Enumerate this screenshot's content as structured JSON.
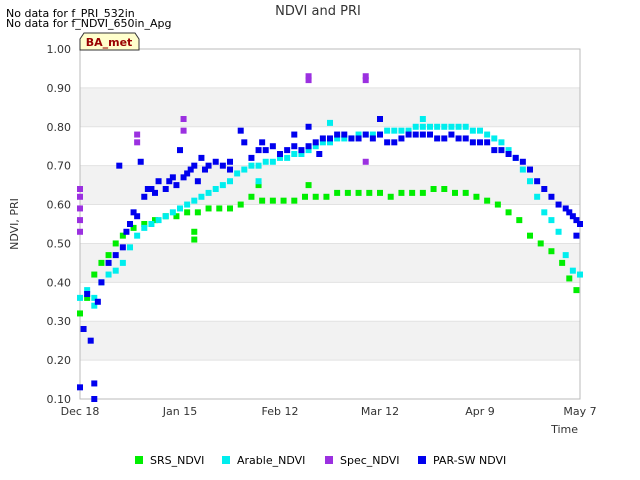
{
  "notes": [
    "No data for f_PRI_532in",
    "No data for f_NDVI_650in_Apg"
  ],
  "badge": {
    "label": "BA_met"
  },
  "chart_data": {
    "type": "scatter",
    "title": "NDVI and PRI",
    "xlabel": "Time",
    "ylabel": "NDVI, PRI",
    "ylim": [
      0.1,
      1.0
    ],
    "yticks": [
      "0.10",
      "0.20",
      "0.30",
      "0.40",
      "0.50",
      "0.60",
      "0.70",
      "0.80",
      "0.90",
      "1.00"
    ],
    "xlim_days": [
      0,
      140
    ],
    "xticks": [
      {
        "label": "Dec 18",
        "day": 0
      },
      {
        "label": "Jan 15",
        "day": 28
      },
      {
        "label": "Feb 12",
        "day": 56
      },
      {
        "label": "Mar 12",
        "day": 84
      },
      {
        "label": "Apr 9",
        "day": 112
      },
      {
        "label": "May 7",
        "day": 140
      }
    ],
    "grid": "horizontal bands",
    "legend_position": "bottom",
    "series": [
      {
        "name": "SRS_NDVI",
        "color": "#00ee00",
        "points": [
          [
            0,
            0.32
          ],
          [
            2,
            0.36
          ],
          [
            4,
            0.42
          ],
          [
            6,
            0.45
          ],
          [
            8,
            0.47
          ],
          [
            10,
            0.5
          ],
          [
            12,
            0.52
          ],
          [
            15,
            0.54
          ],
          [
            18,
            0.55
          ],
          [
            21,
            0.56
          ],
          [
            24,
            0.57
          ],
          [
            27,
            0.57
          ],
          [
            30,
            0.58
          ],
          [
            33,
            0.58
          ],
          [
            36,
            0.59
          ],
          [
            39,
            0.59
          ],
          [
            42,
            0.59
          ],
          [
            45,
            0.6
          ],
          [
            48,
            0.62
          ],
          [
            51,
            0.61
          ],
          [
            54,
            0.61
          ],
          [
            57,
            0.61
          ],
          [
            60,
            0.61
          ],
          [
            63,
            0.62
          ],
          [
            66,
            0.62
          ],
          [
            69,
            0.62
          ],
          [
            72,
            0.63
          ],
          [
            75,
            0.63
          ],
          [
            78,
            0.63
          ],
          [
            81,
            0.63
          ],
          [
            84,
            0.63
          ],
          [
            87,
            0.62
          ],
          [
            90,
            0.63
          ],
          [
            93,
            0.63
          ],
          [
            96,
            0.63
          ],
          [
            99,
            0.64
          ],
          [
            102,
            0.64
          ],
          [
            105,
            0.63
          ],
          [
            108,
            0.63
          ],
          [
            111,
            0.62
          ],
          [
            114,
            0.61
          ],
          [
            117,
            0.6
          ],
          [
            120,
            0.58
          ],
          [
            123,
            0.56
          ],
          [
            126,
            0.52
          ],
          [
            129,
            0.5
          ],
          [
            132,
            0.48
          ],
          [
            135,
            0.45
          ],
          [
            137,
            0.41
          ],
          [
            139,
            0.38
          ],
          [
            32,
            0.51
          ],
          [
            32,
            0.53
          ],
          [
            50,
            0.65
          ],
          [
            64,
            0.65
          ]
        ]
      },
      {
        "name": "Arable_NDVI",
        "color": "#00eeee",
        "points": [
          [
            0,
            0.36
          ],
          [
            2,
            0.38
          ],
          [
            4,
            0.36
          ],
          [
            6,
            0.4
          ],
          [
            8,
            0.42
          ],
          [
            10,
            0.43
          ],
          [
            12,
            0.45
          ],
          [
            14,
            0.49
          ],
          [
            16,
            0.52
          ],
          [
            18,
            0.54
          ],
          [
            20,
            0.55
          ],
          [
            22,
            0.56
          ],
          [
            24,
            0.57
          ],
          [
            26,
            0.58
          ],
          [
            28,
            0.59
          ],
          [
            30,
            0.6
          ],
          [
            32,
            0.61
          ],
          [
            34,
            0.62
          ],
          [
            36,
            0.63
          ],
          [
            38,
            0.64
          ],
          [
            40,
            0.65
          ],
          [
            42,
            0.66
          ],
          [
            44,
            0.68
          ],
          [
            46,
            0.69
          ],
          [
            48,
            0.7
          ],
          [
            50,
            0.7
          ],
          [
            52,
            0.71
          ],
          [
            54,
            0.71
          ],
          [
            56,
            0.72
          ],
          [
            58,
            0.72
          ],
          [
            60,
            0.73
          ],
          [
            62,
            0.73
          ],
          [
            64,
            0.74
          ],
          [
            66,
            0.75
          ],
          [
            68,
            0.76
          ],
          [
            70,
            0.76
          ],
          [
            72,
            0.77
          ],
          [
            74,
            0.77
          ],
          [
            76,
            0.77
          ],
          [
            78,
            0.78
          ],
          [
            80,
            0.78
          ],
          [
            82,
            0.78
          ],
          [
            84,
            0.78
          ],
          [
            86,
            0.79
          ],
          [
            88,
            0.79
          ],
          [
            90,
            0.79
          ],
          [
            92,
            0.79
          ],
          [
            94,
            0.8
          ],
          [
            96,
            0.8
          ],
          [
            98,
            0.8
          ],
          [
            100,
            0.8
          ],
          [
            102,
            0.8
          ],
          [
            104,
            0.8
          ],
          [
            106,
            0.8
          ],
          [
            108,
            0.8
          ],
          [
            110,
            0.79
          ],
          [
            112,
            0.79
          ],
          [
            114,
            0.78
          ],
          [
            116,
            0.77
          ],
          [
            118,
            0.76
          ],
          [
            120,
            0.74
          ],
          [
            122,
            0.72
          ],
          [
            124,
            0.69
          ],
          [
            126,
            0.66
          ],
          [
            128,
            0.62
          ],
          [
            130,
            0.58
          ],
          [
            132,
            0.56
          ],
          [
            134,
            0.53
          ],
          [
            136,
            0.47
          ],
          [
            138,
            0.43
          ],
          [
            140,
            0.42
          ],
          [
            4,
            0.34
          ],
          [
            50,
            0.66
          ],
          [
            70,
            0.81
          ],
          [
            96,
            0.82
          ]
        ]
      },
      {
        "name": "Spec_NDVI",
        "color": "#9b30e0",
        "points": [
          [
            0,
            0.53
          ],
          [
            0,
            0.56
          ],
          [
            0,
            0.59
          ],
          [
            0,
            0.62
          ],
          [
            0,
            0.64
          ],
          [
            16,
            0.76
          ],
          [
            16,
            0.78
          ],
          [
            29,
            0.79
          ],
          [
            29,
            0.82
          ],
          [
            64,
            0.92
          ],
          [
            64,
            0.93
          ],
          [
            80,
            0.92
          ],
          [
            80,
            0.93
          ],
          [
            80,
            0.71
          ]
        ]
      },
      {
        "name": "PAR-SW NDVI",
        "color": "#0000ee",
        "points": [
          [
            0,
            0.13
          ],
          [
            1,
            0.28
          ],
          [
            2,
            0.37
          ],
          [
            3,
            0.25
          ],
          [
            4,
            0.14
          ],
          [
            4,
            0.1
          ],
          [
            5,
            0.35
          ],
          [
            6,
            0.4
          ],
          [
            8,
            0.45
          ],
          [
            10,
            0.47
          ],
          [
            11,
            0.7
          ],
          [
            12,
            0.49
          ],
          [
            13,
            0.53
          ],
          [
            14,
            0.55
          ],
          [
            15,
            0.58
          ],
          [
            16,
            0.57
          ],
          [
            17,
            0.71
          ],
          [
            18,
            0.62
          ],
          [
            19,
            0.64
          ],
          [
            20,
            0.64
          ],
          [
            21,
            0.63
          ],
          [
            22,
            0.66
          ],
          [
            24,
            0.64
          ],
          [
            25,
            0.66
          ],
          [
            26,
            0.67
          ],
          [
            27,
            0.65
          ],
          [
            28,
            0.74
          ],
          [
            29,
            0.67
          ],
          [
            30,
            0.68
          ],
          [
            31,
            0.69
          ],
          [
            32,
            0.7
          ],
          [
            33,
            0.66
          ],
          [
            34,
            0.72
          ],
          [
            35,
            0.69
          ],
          [
            36,
            0.7
          ],
          [
            38,
            0.71
          ],
          [
            40,
            0.7
          ],
          [
            42,
            0.71
          ],
          [
            45,
            0.79
          ],
          [
            46,
            0.76
          ],
          [
            48,
            0.72
          ],
          [
            50,
            0.74
          ],
          [
            51,
            0.76
          ],
          [
            52,
            0.74
          ],
          [
            54,
            0.75
          ],
          [
            56,
            0.73
          ],
          [
            58,
            0.74
          ],
          [
            60,
            0.75
          ],
          [
            60,
            0.78
          ],
          [
            62,
            0.74
          ],
          [
            64,
            0.75
          ],
          [
            64,
            0.8
          ],
          [
            66,
            0.76
          ],
          [
            67,
            0.73
          ],
          [
            68,
            0.77
          ],
          [
            70,
            0.77
          ],
          [
            72,
            0.78
          ],
          [
            74,
            0.78
          ],
          [
            76,
            0.77
          ],
          [
            78,
            0.77
          ],
          [
            80,
            0.78
          ],
          [
            82,
            0.77
          ],
          [
            84,
            0.78
          ],
          [
            86,
            0.76
          ],
          [
            88,
            0.76
          ],
          [
            90,
            0.77
          ],
          [
            92,
            0.78
          ],
          [
            94,
            0.78
          ],
          [
            96,
            0.78
          ],
          [
            98,
            0.78
          ],
          [
            100,
            0.77
          ],
          [
            102,
            0.77
          ],
          [
            104,
            0.78
          ],
          [
            106,
            0.77
          ],
          [
            108,
            0.77
          ],
          [
            110,
            0.76
          ],
          [
            112,
            0.76
          ],
          [
            114,
            0.76
          ],
          [
            116,
            0.74
          ],
          [
            118,
            0.74
          ],
          [
            120,
            0.73
          ],
          [
            122,
            0.72
          ],
          [
            124,
            0.71
          ],
          [
            126,
            0.69
          ],
          [
            128,
            0.66
          ],
          [
            130,
            0.64
          ],
          [
            132,
            0.62
          ],
          [
            134,
            0.6
          ],
          [
            136,
            0.59
          ],
          [
            137,
            0.58
          ],
          [
            138,
            0.57
          ],
          [
            139,
            0.56
          ],
          [
            140,
            0.55
          ],
          [
            139,
            0.52
          ],
          [
            84,
            0.82
          ],
          [
            42,
            0.69
          ]
        ]
      }
    ]
  }
}
